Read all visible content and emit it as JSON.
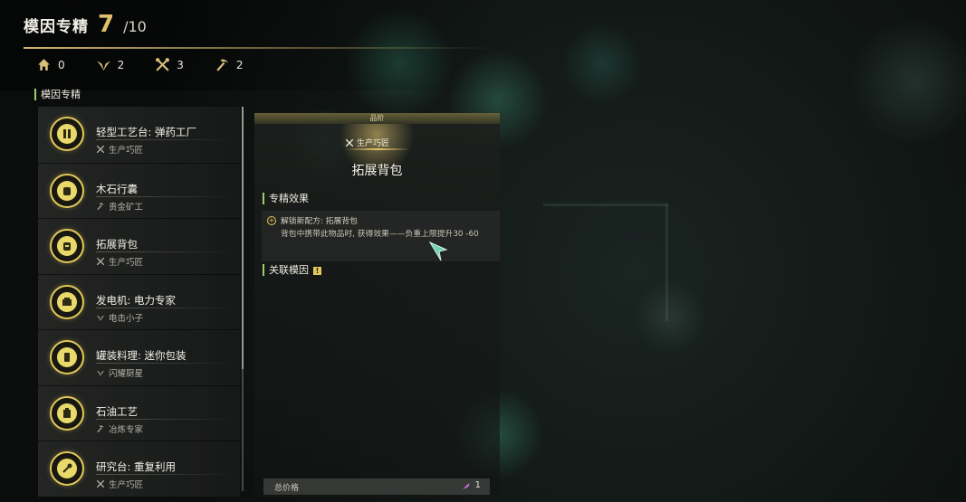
{
  "header": {
    "title": "模因专精",
    "count": "7",
    "max": "/10"
  },
  "stats": [
    {
      "icon": "home-icon",
      "value": "0"
    },
    {
      "icon": "wing-icon",
      "value": "2"
    },
    {
      "icon": "tools-icon",
      "value": "3"
    },
    {
      "icon": "pickaxe-icon",
      "value": "2"
    }
  ],
  "list_section_title": "模因专精",
  "list_items": [
    {
      "title": "轻型工艺台: 弹药工厂",
      "sub": "生产巧匠",
      "sub_icon": "tools-icon"
    },
    {
      "title": "木石行囊",
      "sub": "贵金矿工",
      "sub_icon": "pickaxe-icon"
    },
    {
      "title": "拓展背包",
      "sub": "生产巧匠",
      "sub_icon": "tools-icon"
    },
    {
      "title": "发电机: 电力专家",
      "sub": "电击小子",
      "sub_icon": "wing-icon"
    },
    {
      "title": "罐装料理: 迷你包装",
      "sub": "闪耀厨星",
      "sub_icon": "wing-icon"
    },
    {
      "title": "石油工艺",
      "sub": "冶炼专家",
      "sub_icon": "pickaxe-icon"
    },
    {
      "title": "研究台: 重复利用",
      "sub": "生产巧匠",
      "sub_icon": "tools-icon"
    }
  ],
  "detail": {
    "quality_label": "品阶",
    "spec_tag": "生产巧匠",
    "title": "拓展背包",
    "effect_section": "专精效果",
    "effect_line1": "解锁新配方: 拓展背包",
    "effect_line2": "背包中携带此物品时, 获得效果——负重上限提升30 -60",
    "related_section": "关联模因",
    "price_label": "总价格",
    "price_value": "1"
  },
  "colors": {
    "accent_gold": "#e3c95a",
    "section_green": "#9ccf6a"
  }
}
